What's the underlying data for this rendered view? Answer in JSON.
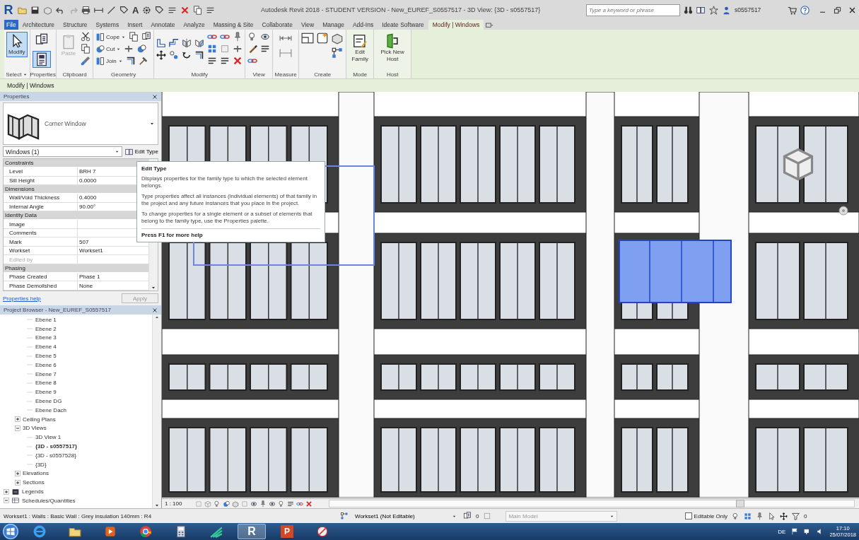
{
  "title_bar": {
    "logo": "R",
    "text_tool": "A",
    "title": "Autodesk Revit 2018 - STUDENT VERSION -   New_EUREF_S0557517 - 3D View: {3D - s0557517}",
    "search": {
      "placeholder": "Type a keyword or phrase"
    },
    "user": "s0557517"
  },
  "ribbon_tabs": [
    {
      "label": "File",
      "kind": "file",
      "selected": false
    },
    {
      "label": "Architecture",
      "kind": "tab",
      "selected": false
    },
    {
      "label": "Structure",
      "kind": "tab",
      "selected": false
    },
    {
      "label": "Systems",
      "kind": "tab",
      "selected": false
    },
    {
      "label": "Insert",
      "kind": "tab",
      "selected": false
    },
    {
      "label": "Annotate",
      "kind": "tab",
      "selected": false
    },
    {
      "label": "Analyze",
      "kind": "tab",
      "selected": false
    },
    {
      "label": "Massing & Site",
      "kind": "tab",
      "selected": false
    },
    {
      "label": "Collaborate",
      "kind": "tab",
      "selected": false
    },
    {
      "label": "View",
      "kind": "tab",
      "selected": false
    },
    {
      "label": "Manage",
      "kind": "tab",
      "selected": false
    },
    {
      "label": "Add-Ins",
      "kind": "tab",
      "selected": false
    },
    {
      "label": "Ideate Software",
      "kind": "tab",
      "selected": false
    },
    {
      "label": "Modify | Windows",
      "kind": "tab",
      "selected": true
    }
  ],
  "ribbon_panels": [
    {
      "kind": "select",
      "label": "Select",
      "buttons": [
        {
          "label": "Modify",
          "selected": true
        }
      ]
    },
    {
      "kind": "properties",
      "label": "Properties",
      "buttons": [
        {
          "selected": false
        },
        {
          "selected": true
        }
      ]
    },
    {
      "kind": "clipboard",
      "label": "Clipboard",
      "buttons": [
        {
          "label": "Paste",
          "disabled": true
        }
      ]
    },
    {
      "kind": "geometry",
      "label": "Geometry",
      "buttons": [
        {
          "label": "Cope",
          "disabled": false
        },
        {
          "label": "Cut",
          "disabled": false
        },
        {
          "label": "Join",
          "disabled": false
        }
      ]
    },
    {
      "kind": "modify",
      "label": "Modify"
    },
    {
      "kind": "view",
      "label": "View"
    },
    {
      "kind": "measure",
      "label": "Measure"
    },
    {
      "kind": "create",
      "label": "Create"
    },
    {
      "kind": "mode",
      "label": "Mode",
      "buttons": [
        {
          "label": "Edit Family"
        }
      ]
    },
    {
      "kind": "host",
      "label": "Host",
      "buttons": [
        {
          "label": "Pick New Host"
        }
      ]
    }
  ],
  "context_bar": {
    "label": "Modify | Windows"
  },
  "properties": {
    "header": "Properties",
    "type_name": "Corner Window",
    "filter": "Windows (1)",
    "edit_type": "Edit Type",
    "sections": [
      {
        "label": "Constraints",
        "rows": [
          {
            "label": "Level",
            "value": "BRH 7",
            "disabled": false
          },
          {
            "label": "Sill Height",
            "value": "0.0000",
            "disabled": false
          }
        ]
      },
      {
        "label": "Dimensions",
        "rows": [
          {
            "label": "Wall/Void Thickness",
            "value": "0.4000",
            "disabled": false
          },
          {
            "label": "Internal Angle",
            "value": "90.00°",
            "disabled": false
          }
        ]
      },
      {
        "label": "Identity Data",
        "rows": [
          {
            "label": "Image",
            "disabled": false
          },
          {
            "label": "Comments",
            "disabled": false
          },
          {
            "label": "Mark",
            "value": "507",
            "disabled": false
          },
          {
            "label": "Workset",
            "value": "Workset1",
            "disabled": false
          },
          {
            "label": "Edited by",
            "disabled": true
          }
        ]
      },
      {
        "label": "Phasing",
        "rows": [
          {
            "label": "Phase Created",
            "value": "Phase 1",
            "disabled": false
          },
          {
            "label": "Phase Demolished",
            "value": "None",
            "disabled": false
          }
        ]
      }
    ],
    "help_link": "Properties help",
    "apply": {
      "label": "Apply",
      "disabled": true
    }
  },
  "tooltip": {
    "title": "Edit Type",
    "paragraphs": [
      "Displays properties for the family type to which the selected element belongs.",
      "Type properties affect all instances (individual elements) of that family in the project and any future instances that you place in the project.",
      "To change properties for a single element or a subset of elements that belong to the family type, use the Properties palette."
    ],
    "footer": "Press F1 for more help"
  },
  "project_browser": {
    "header": "Project Browser - New_EUREF_S0557517",
    "tree": [
      {
        "children": [
          {
            "children": [
              {
                "label": "Ebene 1"
              },
              {
                "label": "Ebene 2"
              },
              {
                "label": "Ebene 3"
              },
              {
                "label": "Ebene 4"
              },
              {
                "label": "Ebene 5"
              },
              {
                "label": "Ebene 6"
              },
              {
                "label": "Ebene 7"
              },
              {
                "label": "Ebene 8"
              },
              {
                "label": "Ebene 9"
              },
              {
                "label": "Ebene DG"
              },
              {
                "label": "Ebene Dach"
              }
            ]
          },
          {
            "label": "Ceiling Plans",
            "expanded": false
          },
          {
            "label": "3D Views",
            "expanded": true,
            "children": [
              {
                "label": "3D View 1",
                "active": false
              },
              {
                "label": "{3D - s0557517}",
                "active": true
              },
              {
                "label": "{3D - s0557528}",
                "active": false
              },
              {
                "label": "{3D}",
                "active": false
              }
            ]
          },
          {
            "label": "Elevations",
            "expanded": false
          },
          {
            "label": "Sections",
            "expanded": false
          }
        ]
      },
      {
        "label": "Legends",
        "kind": "legends",
        "expanded": false
      },
      {
        "label": "Schedules/Quantities",
        "kind": "schedules",
        "expanded": true
      }
    ]
  },
  "view": {
    "scale": "1 : 100"
  },
  "status_bar": {
    "message": "Workset1 : Walls : Basic Wall : Grey insulation 140mm : R4",
    "workset": "Workset1 (Not Editable)",
    "worksets_count": "0",
    "design_option": "Main Model",
    "editable_only": {
      "label": "Editable Only",
      "checked": false
    },
    "filter_count": "0"
  },
  "taskbar": {
    "apps": [
      {
        "kind": "ie",
        "selected": false
      },
      {
        "kind": "explorer",
        "selected": false
      },
      {
        "kind": "media",
        "selected": false
      },
      {
        "kind": "chrome",
        "selected": false
      },
      {
        "kind": "calculator",
        "selected": false
      },
      {
        "kind": "green",
        "selected": false
      },
      {
        "kind": "revit",
        "label": "R",
        "selected": true
      },
      {
        "kind": "powerpoint",
        "label": "P",
        "selected": false
      },
      {
        "kind": "snipping",
        "selected": false
      }
    ],
    "language": "DE",
    "time": "17:10",
    "date": "25/07/2018"
  }
}
